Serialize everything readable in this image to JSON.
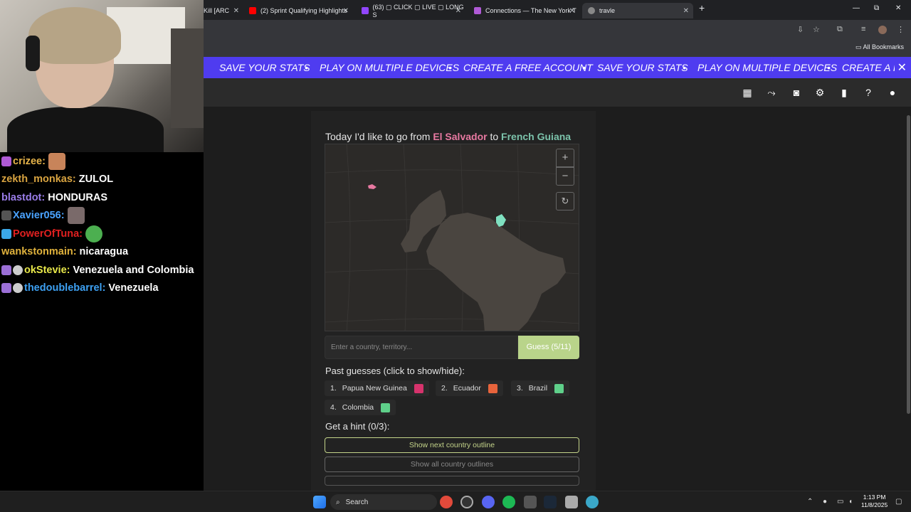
{
  "chat": {
    "lines": [
      {
        "user": "crizee:",
        "msg": "",
        "color": "#e6b34a"
      },
      {
        "user": "zekth_monkas:",
        "msg": "ZULOL",
        "color": "#d9a441"
      },
      {
        "user": "blastdot:",
        "msg": "HONDURAS",
        "color": "#9a7de8"
      },
      {
        "user": "Xavier056:",
        "msg": "",
        "color": "#4aa3ff"
      },
      {
        "user": "PowerOfTuna:",
        "msg": "",
        "color": "#e02020"
      },
      {
        "user": "wankstonmain:",
        "msg": "nicaragua",
        "color": "#e0b23c"
      },
      {
        "user": "okStevie:",
        "msg": "Venezuela and Colombia",
        "color": "#e8e84a"
      },
      {
        "user": "thedoublebarrel:",
        "msg": "Venezuela",
        "color": "#3da0f2"
      }
    ]
  },
  "browser": {
    "tabs": [
      {
        "label": "Kill [ARC"
      },
      {
        "label": "(2) Sprint Qualifying Highlights"
      },
      {
        "label": "(63) ▢ CLICK ▢ LIVE ▢ LONG S"
      },
      {
        "label": "Connections — The New York T"
      },
      {
        "label": "travle"
      }
    ],
    "new_tab": "+",
    "minimize": "—",
    "restore": "⧉",
    "close": "✕",
    "all_bookmarks": "All Bookmarks"
  },
  "marquee": {
    "items": [
      "SAVE YOUR STATS",
      "•",
      "PLAY ON MULTIPLE DEVICES",
      "•",
      "CREATE A FREE ACCOUNT",
      "•",
      "SAVE YOUR STATS",
      "•",
      "PLAY ON MULTIPLE DEVICES",
      "•",
      "CREATE A FI"
    ],
    "close": "✕"
  },
  "game": {
    "prompt_prefix": "Today I'd like to go from",
    "from": "El Salvador",
    "prompt_mid": "to",
    "to": "French Guiana",
    "zoom_in": "+",
    "zoom_out": "−",
    "reset": "↻",
    "input_placeholder": "Enter a country, territory...",
    "guess_button": "Guess (5/11)",
    "past_label": "Past guesses (click to show/hide):",
    "guesses": [
      {
        "num": "1.",
        "name": "Papua New Guinea",
        "color": "#d6336c"
      },
      {
        "num": "2.",
        "name": "Ecuador",
        "color": "#e8643c"
      },
      {
        "num": "3.",
        "name": "Brazil",
        "color": "#5fd08a"
      },
      {
        "num": "4.",
        "name": "Colombia",
        "color": "#5fd08a"
      }
    ],
    "hint_label": "Get a hint (0/3):",
    "hint_next": "Show next country outline",
    "hint_all": "Show all country outlines",
    "accent": "#4f3cf0",
    "guess_button_color": "#b9d48a"
  },
  "taskbar": {
    "search": "Search",
    "time": "1:13 PM",
    "date": "11/8/2025"
  }
}
